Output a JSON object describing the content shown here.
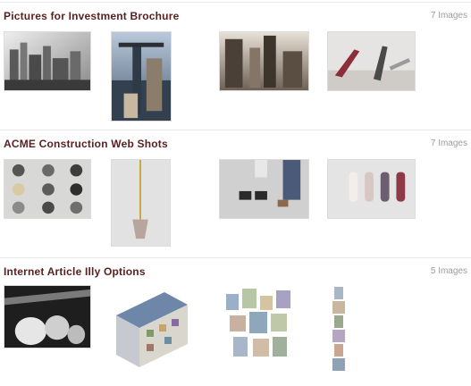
{
  "sections": [
    {
      "title": "Pictures for Investment Brochure",
      "count": "7 Images",
      "thumbs": [
        "city-skyline-photo",
        "tower-crane-photo",
        "skyscraper-construction-photo",
        "bridge-cables-photo"
      ]
    },
    {
      "title": "ACME Construction Web Shots",
      "count": "7 Images",
      "thumbs": [
        "gravel-samples-photo",
        "plumb-bob-photo",
        "worker-boots-photo",
        "paint-swatches-photo"
      ]
    },
    {
      "title": "Internet Article Illy Options",
      "count": "5 Images",
      "thumbs": [
        "satellite-dishes-photo",
        "isometric-building-illustration",
        "isometric-city-illustration",
        "isometric-tower-illustration"
      ]
    }
  ],
  "colors": {
    "title": "#5a1f1f",
    "count": "#9c9c9c",
    "divider": "#e9e9e9"
  }
}
